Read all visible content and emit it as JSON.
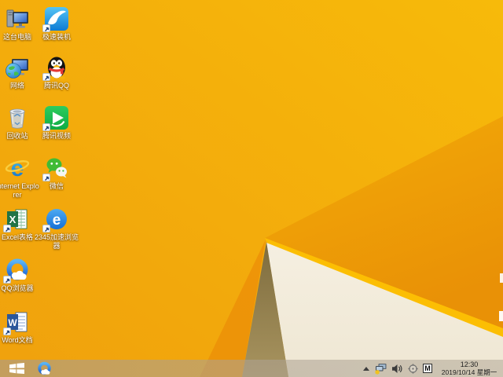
{
  "wallpaper": {
    "theme": "windows-8.1-default-orange",
    "colors": {
      "base_left": "#f0a10d",
      "base_right": "#f7ba0a",
      "dark_facet": "#ec9806",
      "edge_stripe": "#fcbe03",
      "cream_facet": "#f3edde",
      "tan_facet": "#998550"
    }
  },
  "desktop": {
    "icons": [
      {
        "id": "this-pc",
        "label": "这台电脑",
        "shortcut": false
      },
      {
        "id": "xunlei-install",
        "label": "极速装机",
        "shortcut": true
      },
      {
        "id": "network",
        "label": "网络",
        "shortcut": false
      },
      {
        "id": "tencent-qq",
        "label": "腾讯QQ",
        "shortcut": true
      },
      {
        "id": "recycle-bin",
        "label": "回收站",
        "shortcut": false
      },
      {
        "id": "tencent-video",
        "label": "腾讯视频",
        "shortcut": true
      },
      {
        "id": "internet-explorer",
        "label": "Internet Explorer",
        "shortcut": false
      },
      {
        "id": "wechat",
        "label": "微信",
        "shortcut": true
      },
      {
        "id": "excel",
        "label": "Excel表格",
        "shortcut": true
      },
      {
        "id": "2345-browser",
        "label": "2345加速浏览器",
        "shortcut": true
      },
      {
        "id": "qq-browser",
        "label": "QQ浏览器",
        "shortcut": true
      },
      {
        "id": "word",
        "label": "Word文档",
        "shortcut": true
      }
    ]
  },
  "taskbar": {
    "pinned": [
      {
        "id": "qq-browser-task"
      }
    ],
    "tray": {
      "ime_indicator": "M",
      "icons": [
        "show-hidden",
        "network-status",
        "volume",
        "crosshair-utility",
        "ime"
      ]
    },
    "clock": {
      "time": "12:30",
      "date": "2019/10/14 星期一"
    }
  }
}
